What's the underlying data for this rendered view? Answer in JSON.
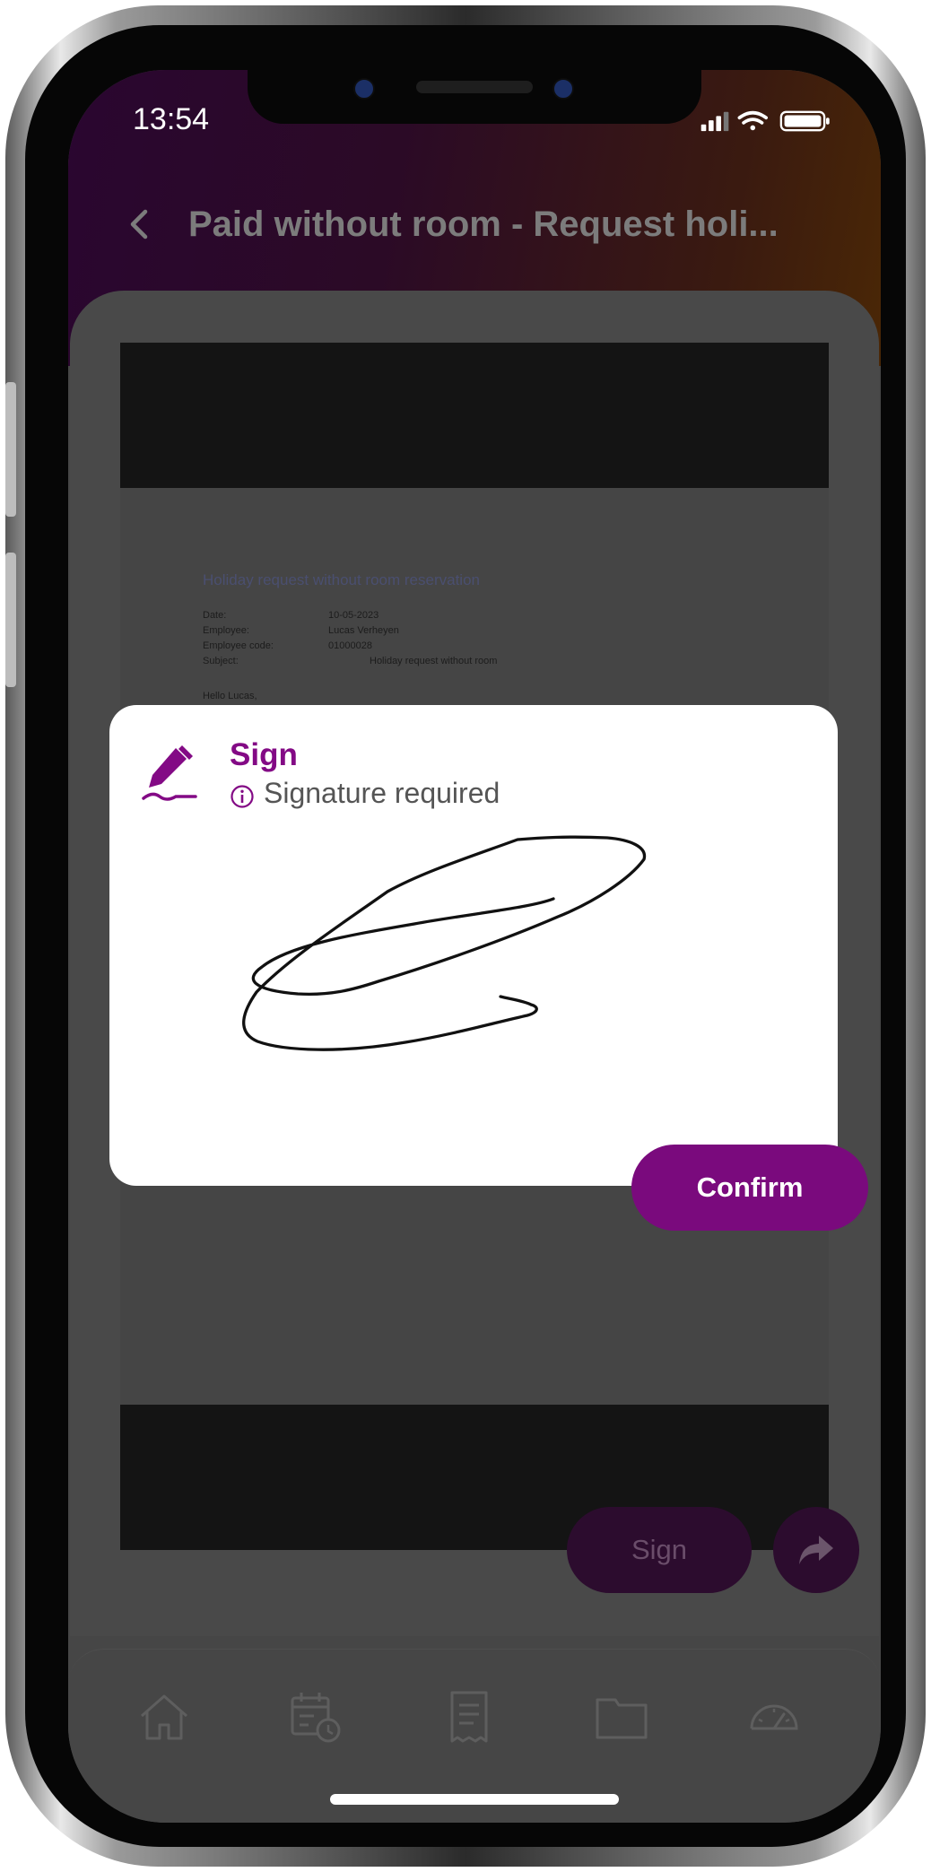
{
  "status_bar": {
    "time": "13:54"
  },
  "header": {
    "title": "Paid without room - Request holi..."
  },
  "document": {
    "heading": "Holiday request without room reservation",
    "rows": [
      {
        "key": "Date:",
        "value": "10-05-2023"
      },
      {
        "key": "Employee:",
        "value": "Lucas Verheyen"
      },
      {
        "key": "Employee code:",
        "value": "01000028"
      },
      {
        "key": "Subject:",
        "value": "Holiday request without room"
      }
    ],
    "greeting": "Hello Lucas,"
  },
  "dialog": {
    "title": "Sign",
    "subtitle": "Signature required",
    "confirm_label": "Confirm"
  },
  "actions": {
    "sign_label": "Sign"
  },
  "bottom_nav": {
    "items": [
      "home-icon",
      "calendar-clock-icon",
      "receipt-icon",
      "folder-icon",
      "speedometer-icon"
    ]
  },
  "colors": {
    "accent": "#7a0a7d",
    "dim_accent": "#2c0c2e"
  }
}
